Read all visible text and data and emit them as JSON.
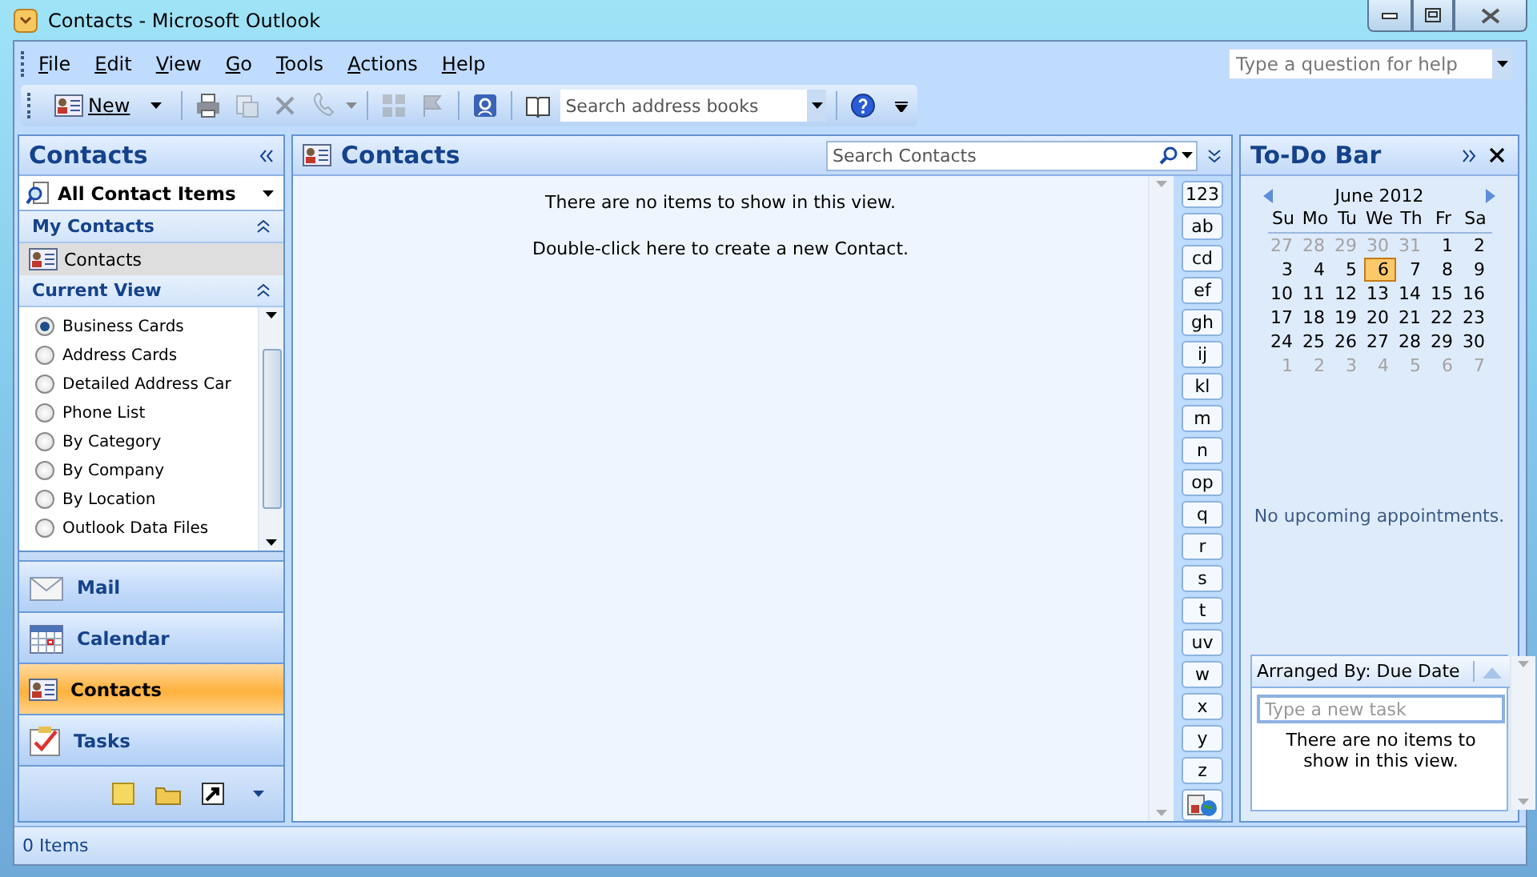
{
  "window": {
    "title": "Contacts - Microsoft Outlook"
  },
  "menu": [
    "File",
    "Edit",
    "View",
    "Go",
    "Tools",
    "Actions",
    "Help"
  ],
  "help_search": {
    "placeholder": "Type a question for help"
  },
  "toolbar": {
    "new_button": "New",
    "address_search": {
      "placeholder": "Search address books"
    }
  },
  "navigation_pane": {
    "title": "Contacts",
    "folder_selector": "All Contact Items",
    "my_contacts": {
      "title": "My Contacts",
      "expanded": true,
      "items": [
        {
          "label": "Contacts",
          "selected": true
        }
      ]
    },
    "current_view": {
      "title": "Current View",
      "expanded": true,
      "views": [
        {
          "label": "Business Cards",
          "selected": true
        },
        {
          "label": "Address Cards",
          "selected": false
        },
        {
          "label": "Detailed Address Car",
          "selected": false
        },
        {
          "label": "Phone List",
          "selected": false
        },
        {
          "label": "By Category",
          "selected": false
        },
        {
          "label": "By Company",
          "selected": false
        },
        {
          "label": "By Location",
          "selected": false
        },
        {
          "label": "Outlook Data Files",
          "selected": false
        }
      ]
    },
    "buttons": [
      {
        "label": "Mail",
        "selected": false
      },
      {
        "label": "Calendar",
        "selected": false
      },
      {
        "label": "Contacts",
        "selected": true
      },
      {
        "label": "Tasks",
        "selected": false
      }
    ]
  },
  "content": {
    "title": "Contacts",
    "search": {
      "placeholder": "Search Contacts"
    },
    "empty_message": "There are no items to show in this view.",
    "create_hint": "Double-click here to create a new Contact.",
    "index_tabs": [
      "123",
      "ab",
      "cd",
      "ef",
      "gh",
      "ij",
      "kl",
      "m",
      "n",
      "op",
      "q",
      "r",
      "s",
      "t",
      "uv",
      "w",
      "x",
      "y",
      "z"
    ]
  },
  "todo_bar": {
    "title": "To-Do Bar",
    "calendar": {
      "month": "June 2012",
      "weekdays": [
        "Su",
        "Mo",
        "Tu",
        "We",
        "Th",
        "Fr",
        "Sa"
      ],
      "weeks": [
        [
          {
            "day": "27",
            "other_month": true,
            "selected": false
          },
          {
            "day": "28",
            "other_month": true,
            "selected": false
          },
          {
            "day": "29",
            "other_month": true,
            "selected": false
          },
          {
            "day": "30",
            "other_month": true,
            "selected": false
          },
          {
            "day": "31",
            "other_month": true,
            "selected": false
          },
          {
            "day": "1",
            "other_month": false,
            "selected": false
          },
          {
            "day": "2",
            "other_month": false,
            "selected": false
          }
        ],
        [
          {
            "day": "3",
            "other_month": false,
            "selected": false
          },
          {
            "day": "4",
            "other_month": false,
            "selected": false
          },
          {
            "day": "5",
            "other_month": false,
            "selected": false
          },
          {
            "day": "6",
            "other_month": false,
            "selected": true
          },
          {
            "day": "7",
            "other_month": false,
            "selected": false
          },
          {
            "day": "8",
            "other_month": false,
            "selected": false
          },
          {
            "day": "9",
            "other_month": false,
            "selected": false
          }
        ],
        [
          {
            "day": "10",
            "other_month": false,
            "selected": false
          },
          {
            "day": "11",
            "other_month": false,
            "selected": false
          },
          {
            "day": "12",
            "other_month": false,
            "selected": false
          },
          {
            "day": "13",
            "other_month": false,
            "selected": false
          },
          {
            "day": "14",
            "other_month": false,
            "selected": false
          },
          {
            "day": "15",
            "other_month": false,
            "selected": false
          },
          {
            "day": "16",
            "other_month": false,
            "selected": false
          }
        ],
        [
          {
            "day": "17",
            "other_month": false,
            "selected": false
          },
          {
            "day": "18",
            "other_month": false,
            "selected": false
          },
          {
            "day": "19",
            "other_month": false,
            "selected": false
          },
          {
            "day": "20",
            "other_month": false,
            "selected": false
          },
          {
            "day": "21",
            "other_month": false,
            "selected": false
          },
          {
            "day": "22",
            "other_month": false,
            "selected": false
          },
          {
            "day": "23",
            "other_month": false,
            "selected": false
          }
        ],
        [
          {
            "day": "24",
            "other_month": false,
            "selected": false
          },
          {
            "day": "25",
            "other_month": false,
            "selected": false
          },
          {
            "day": "26",
            "other_month": false,
            "selected": false
          },
          {
            "day": "27",
            "other_month": false,
            "selected": false
          },
          {
            "day": "28",
            "other_month": false,
            "selected": false
          },
          {
            "day": "29",
            "other_month": false,
            "selected": false
          },
          {
            "day": "30",
            "other_month": false,
            "selected": false
          }
        ],
        [
          {
            "day": "1",
            "other_month": true,
            "selected": false
          },
          {
            "day": "2",
            "other_month": true,
            "selected": false
          },
          {
            "day": "3",
            "other_month": true,
            "selected": false
          },
          {
            "day": "4",
            "other_month": true,
            "selected": false
          },
          {
            "day": "5",
            "other_month": true,
            "selected": false
          },
          {
            "day": "6",
            "other_month": true,
            "selected": false
          },
          {
            "day": "7",
            "other_month": true,
            "selected": false
          }
        ]
      ]
    },
    "appointments_message": "No upcoming appointments.",
    "tasks": {
      "arranged_by": "Arranged By: Due Date",
      "new_task": {
        "placeholder": "Type a new task"
      },
      "empty_message": "There are no items to show in this view."
    }
  },
  "status_bar": {
    "text": "0 Items"
  }
}
